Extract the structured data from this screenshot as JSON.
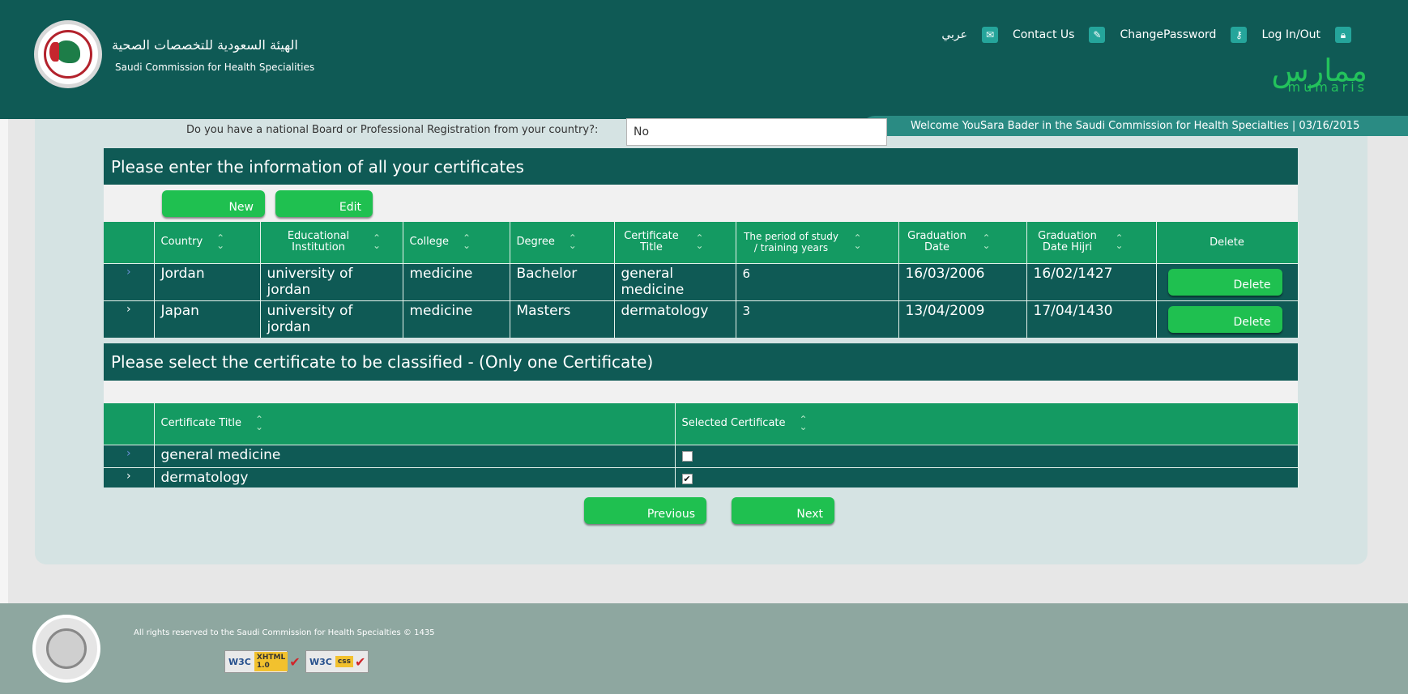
{
  "header": {
    "org_ar": "الهيئة السعودية للتخصصات الصحية",
    "org_en": "Saudi Commission for Health Specialities",
    "nav": {
      "arabic": "عربي",
      "contact": "Contact Us",
      "change_password": "ChangePassword",
      "login": "Log In/Out"
    },
    "brand_ar": "ممارس",
    "brand_en": "mumaris",
    "welcome": "Welcome YouSara Bader in the Saudi Commission for Health Specialties    |    03/16/2015"
  },
  "question": {
    "label": "Do you have a national Board or Professional Registration from your country?:",
    "value": "No"
  },
  "certificates": {
    "title": "Please enter the information of all your certificates",
    "new_label": "New",
    "edit_label": "Edit",
    "headers": [
      "Country",
      "Educational Institution",
      "College",
      "Degree",
      "Certificate Title",
      "The period of study / training years",
      "Graduation Date",
      "Graduation Date Hijri",
      "Delete"
    ],
    "rows": [
      {
        "country": "Jordan",
        "institution": "university of jordan",
        "college": "medicine",
        "degree": "Bachelor",
        "title": "general medicine",
        "period": "6",
        "grad": "16/03/2006",
        "hijri": "16/02/1427",
        "delete": "Delete"
      },
      {
        "country": "Japan",
        "institution": "university of jordan",
        "college": "medicine",
        "degree": "Masters",
        "title": "dermatology",
        "period": "3",
        "grad": "13/04/2009",
        "hijri": "17/04/1430",
        "delete": "Delete"
      }
    ]
  },
  "classify": {
    "title": "Please select the certificate to be classified - (Only one Certificate)",
    "headers": [
      "Certificate Title",
      "Selected Certificate"
    ],
    "rows": [
      {
        "title": "general medicine",
        "selected": false
      },
      {
        "title": "dermatology",
        "selected": true
      }
    ]
  },
  "nav_buttons": {
    "previous": "Previous",
    "next": "Next"
  },
  "footer": {
    "copyright": "All rights reserved to the Saudi Commission for Health Specialties © 1435",
    "badge_xhtml": "XHTML 1.0",
    "badge_css": "css",
    "w3c": "W3C"
  }
}
